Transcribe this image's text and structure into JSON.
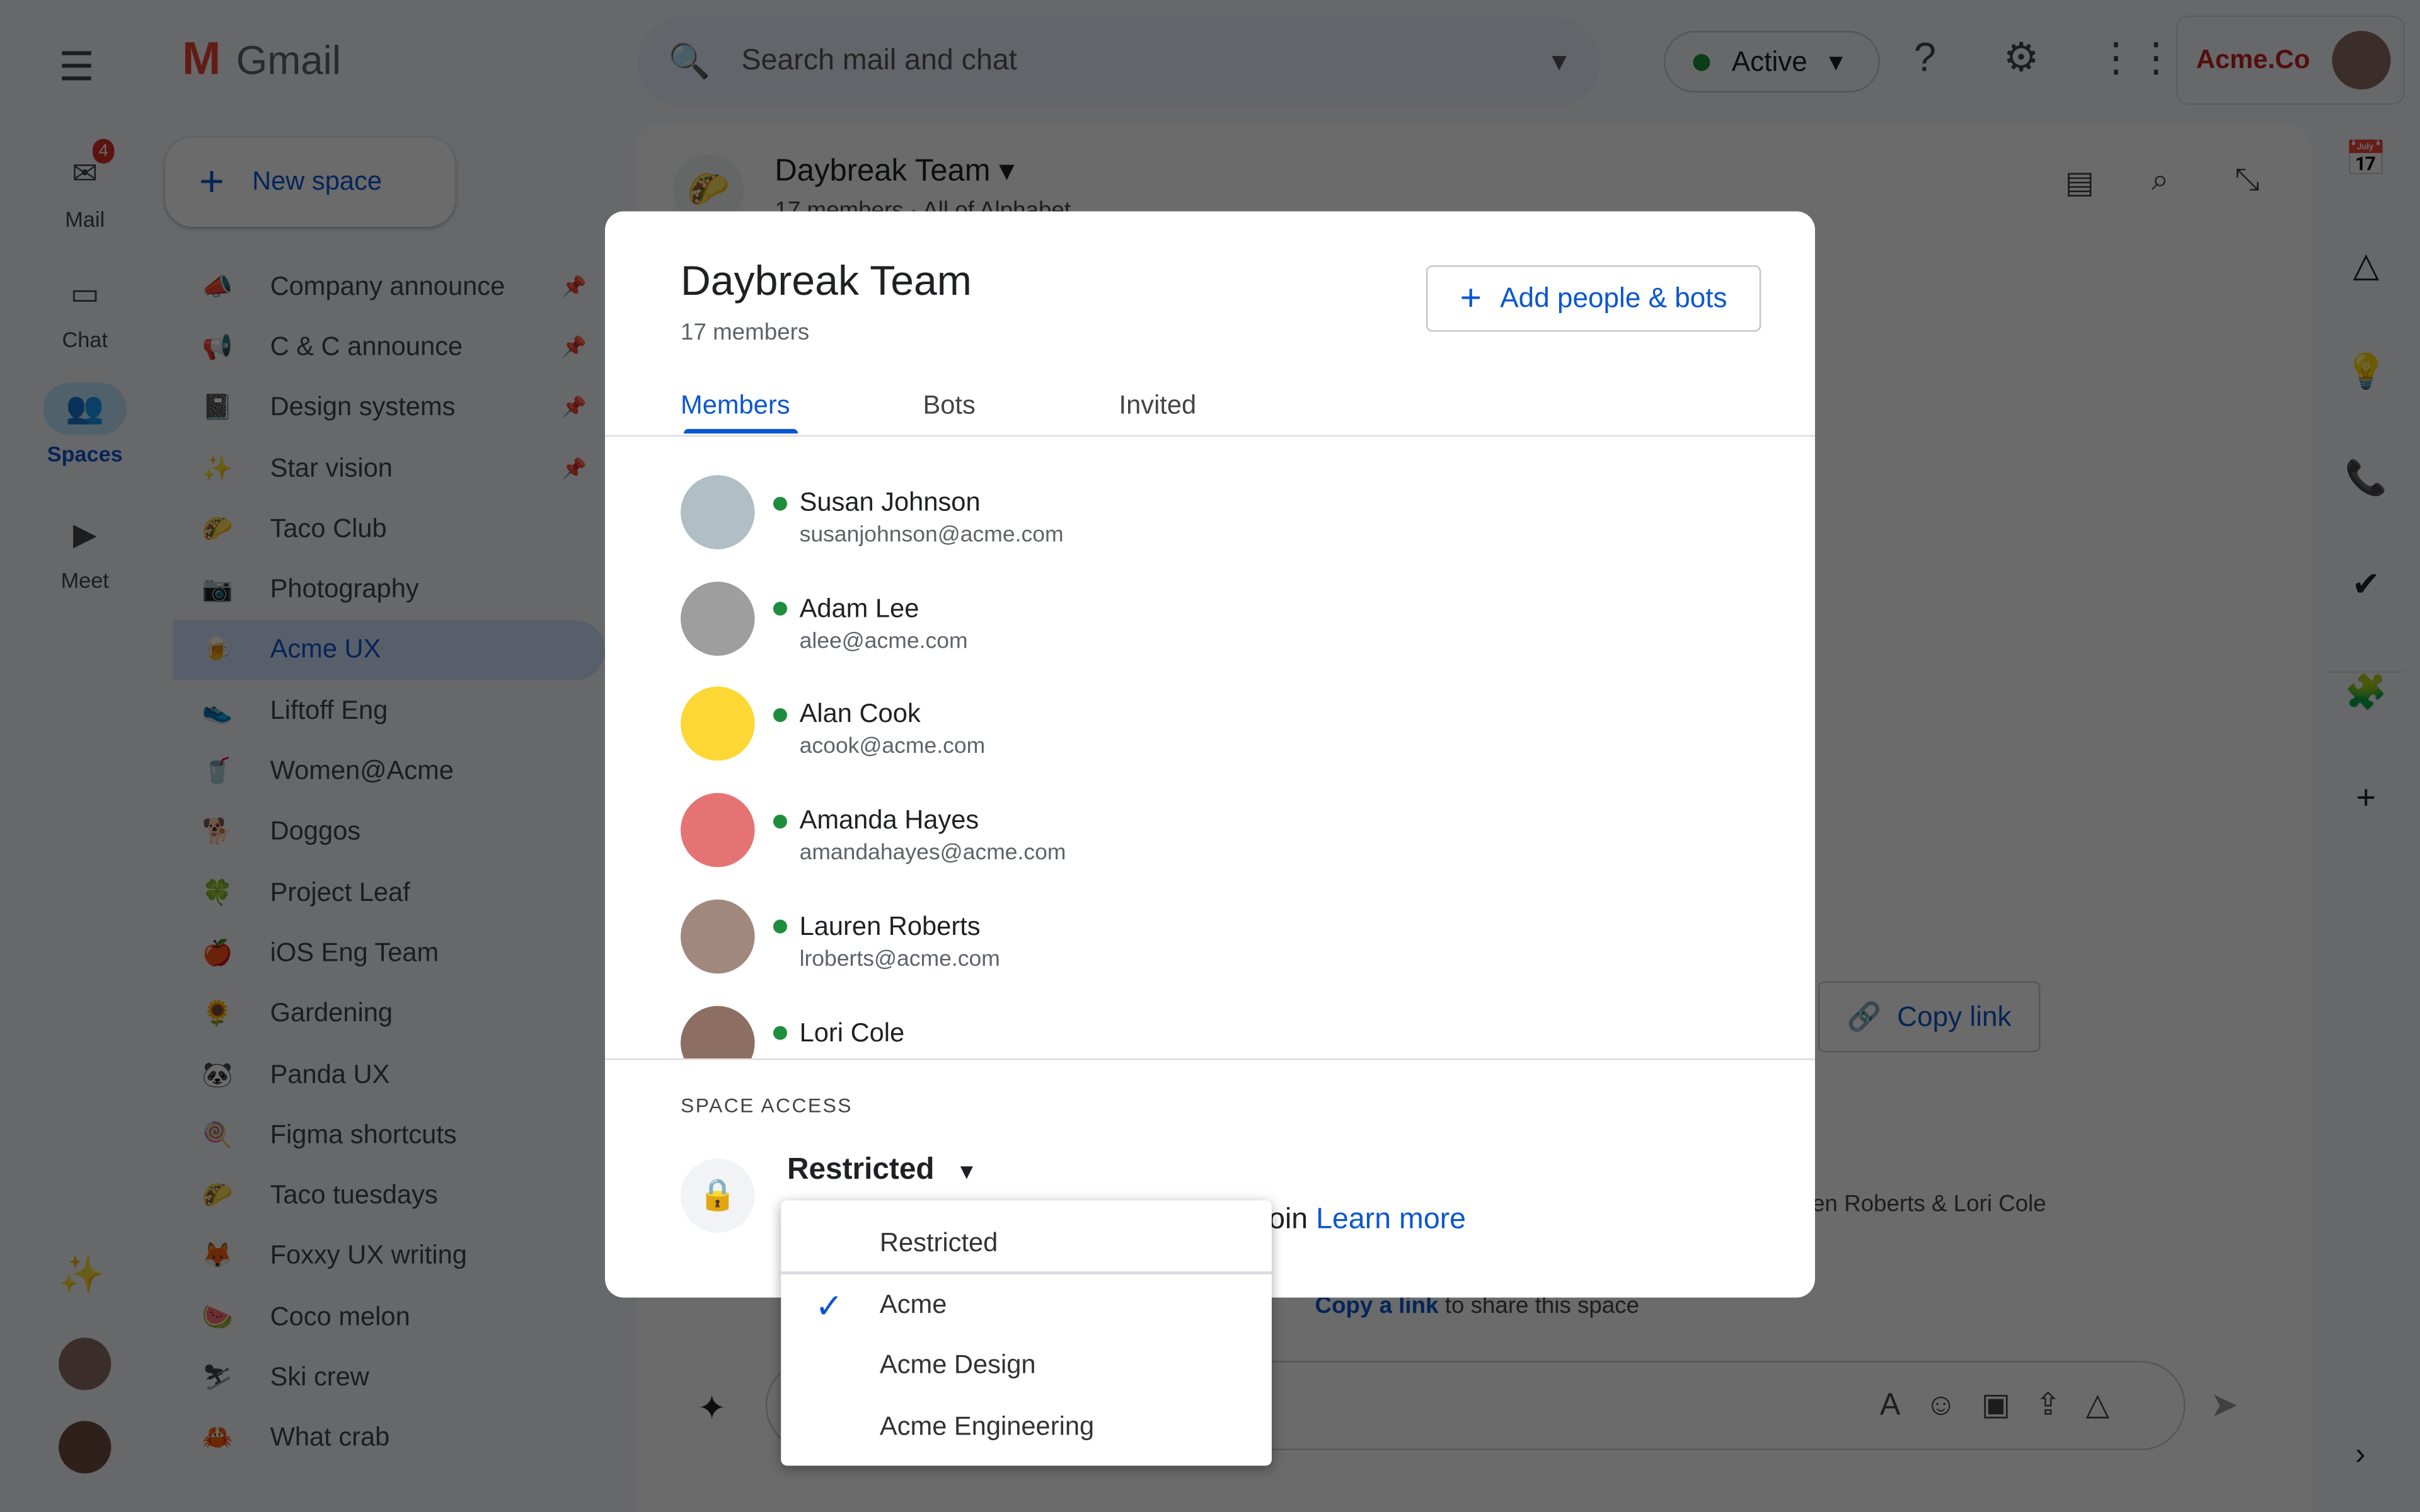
{
  "app": {
    "logo_text": "Gmail"
  },
  "rail": [
    {
      "label": "Mail",
      "icon": "mail-icon",
      "badge": "4"
    },
    {
      "label": "Chat",
      "icon": "chat-icon"
    },
    {
      "label": "Spaces",
      "icon": "spaces-icon",
      "active": true
    },
    {
      "label": "Meet",
      "icon": "video-icon"
    }
  ],
  "new_space_label": "New space",
  "spaces": [
    {
      "name": "Company announce",
      "icon": "📣",
      "pinned": true
    },
    {
      "name": "C & C announce",
      "icon": "📢",
      "pinned": true
    },
    {
      "name": "Design systems",
      "icon": "📓",
      "pinned": true
    },
    {
      "name": "Star vision",
      "icon": "✨",
      "pinned": true
    },
    {
      "name": "Taco Club",
      "icon": "🌮"
    },
    {
      "name": "Photography",
      "icon": "📷"
    },
    {
      "name": "Acme UX",
      "icon": "🍺",
      "selected": true
    },
    {
      "name": "Liftoff Eng",
      "icon": "👟"
    },
    {
      "name": "Women@Acme",
      "icon": "🥤"
    },
    {
      "name": "Doggos",
      "icon": "🐕"
    },
    {
      "name": "Project Leaf",
      "icon": "🍀"
    },
    {
      "name": "iOS Eng Team",
      "icon": "🍎"
    },
    {
      "name": "Gardening",
      "icon": "🌻"
    },
    {
      "name": "Panda UX",
      "icon": "🐼"
    },
    {
      "name": "Figma shortcuts",
      "icon": "🍭"
    },
    {
      "name": "Taco tuesdays",
      "icon": "🌮"
    },
    {
      "name": "Foxxy UX writing",
      "icon": "🦊"
    },
    {
      "name": "Coco melon",
      "icon": "🍉"
    },
    {
      "name": "Ski crew",
      "icon": "⛷"
    },
    {
      "name": "What crab",
      "icon": "🦀"
    }
  ],
  "search": {
    "placeholder": "Search mail and chat"
  },
  "status": {
    "label": "Active",
    "color": "#1e8e3e"
  },
  "account": {
    "org": "Acme.Co"
  },
  "background_space": {
    "title": "Daybreak Team",
    "subtitle": "17 members · All of Alphabet",
    "copy_link": "Copy link",
    "added_text": "en Roberts & Lori Cole",
    "copy_a_link": "Copy a link",
    "share_text": " to share this space"
  },
  "dialog": {
    "title": "Daybreak Team",
    "member_count": "17 members",
    "add_button": "Add people & bots",
    "tabs": [
      {
        "label": "Members",
        "active": true
      },
      {
        "label": "Bots"
      },
      {
        "label": "Invited"
      }
    ],
    "members": [
      {
        "name": "Susan Johnson",
        "email": "susanjohnson@acme.com",
        "online": true
      },
      {
        "name": "Adam Lee",
        "email": "alee@acme.com",
        "online": true
      },
      {
        "name": "Alan Cook",
        "email": "acook@acme.com",
        "online": true
      },
      {
        "name": "Amanda Hayes",
        "email": "amandahayes@acme.com",
        "online": true
      },
      {
        "name": "Lauren Roberts",
        "email": "lroberts@acme.com",
        "online": true
      },
      {
        "name": "Lori Cole",
        "email": "",
        "online": true
      }
    ],
    "space_access_label": "SPACE ACCESS",
    "access_value": "Restricted",
    "help_partial": "oin",
    "learn_more": "Learn more",
    "menu": [
      {
        "label": "Restricted"
      },
      {
        "label": "Acme",
        "checked": true
      },
      {
        "label": "Acme Design"
      },
      {
        "label": "Acme Engineering"
      }
    ]
  },
  "colors": {
    "accent": "#0b57d0",
    "online": "#1e8e3e"
  }
}
